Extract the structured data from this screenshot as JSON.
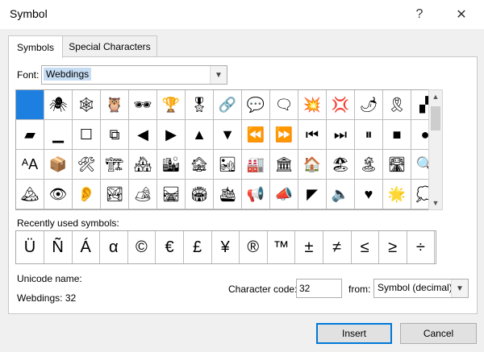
{
  "window": {
    "title": "Symbol",
    "help": "?",
    "close": "✕"
  },
  "tabs": [
    {
      "label": "Symbols",
      "active": true
    },
    {
      "label": "Special Characters",
      "active": false
    }
  ],
  "font": {
    "label": "Font:",
    "value": "Webdings"
  },
  "grid": {
    "rows": [
      [
        "",
        "🕷",
        "🕸",
        "🦉",
        "🕶",
        "🏆",
        "🎖",
        "🔗",
        "💬",
        "🗨",
        "💥",
        "💢",
        "🌶",
        "🎗",
        "▞"
      ],
      [
        "▰",
        "▁",
        "☐",
        "⧉",
        "◀",
        "▶",
        "▲",
        "▼",
        "⏪",
        "⏩",
        "⏮",
        "⏭",
        "⏸",
        "■",
        "●"
      ],
      [
        "ᴬA",
        "📦",
        "🛠",
        "🏗",
        "🏘",
        "🏙",
        "🏚",
        "🏜",
        "🏭",
        "🏛",
        "🏠",
        "🏖",
        "🏝",
        "🛣",
        "🔍"
      ],
      [
        "🏔",
        "👁",
        "👂",
        "🏞",
        "🏕",
        "🛤",
        "🏟",
        "🛳",
        "📢",
        "📣",
        "◤",
        "🔈",
        "♥",
        "🌟",
        "💭"
      ]
    ]
  },
  "recent": {
    "label": "Recently used symbols:",
    "symbols": [
      "Ü",
      "Ñ",
      "Á",
      "α",
      "©",
      "€",
      "£",
      "¥",
      "®",
      "™",
      "±",
      "≠",
      "≤",
      "≥",
      "÷"
    ]
  },
  "unicode": {
    "label": "Unicode name:",
    "value": "Webdings: 32"
  },
  "character_code": {
    "label": "Character code:",
    "value": "32"
  },
  "from": {
    "label": "from:",
    "value": "Symbol (decimal)"
  },
  "buttons": {
    "insert": "Insert",
    "cancel": "Cancel"
  }
}
